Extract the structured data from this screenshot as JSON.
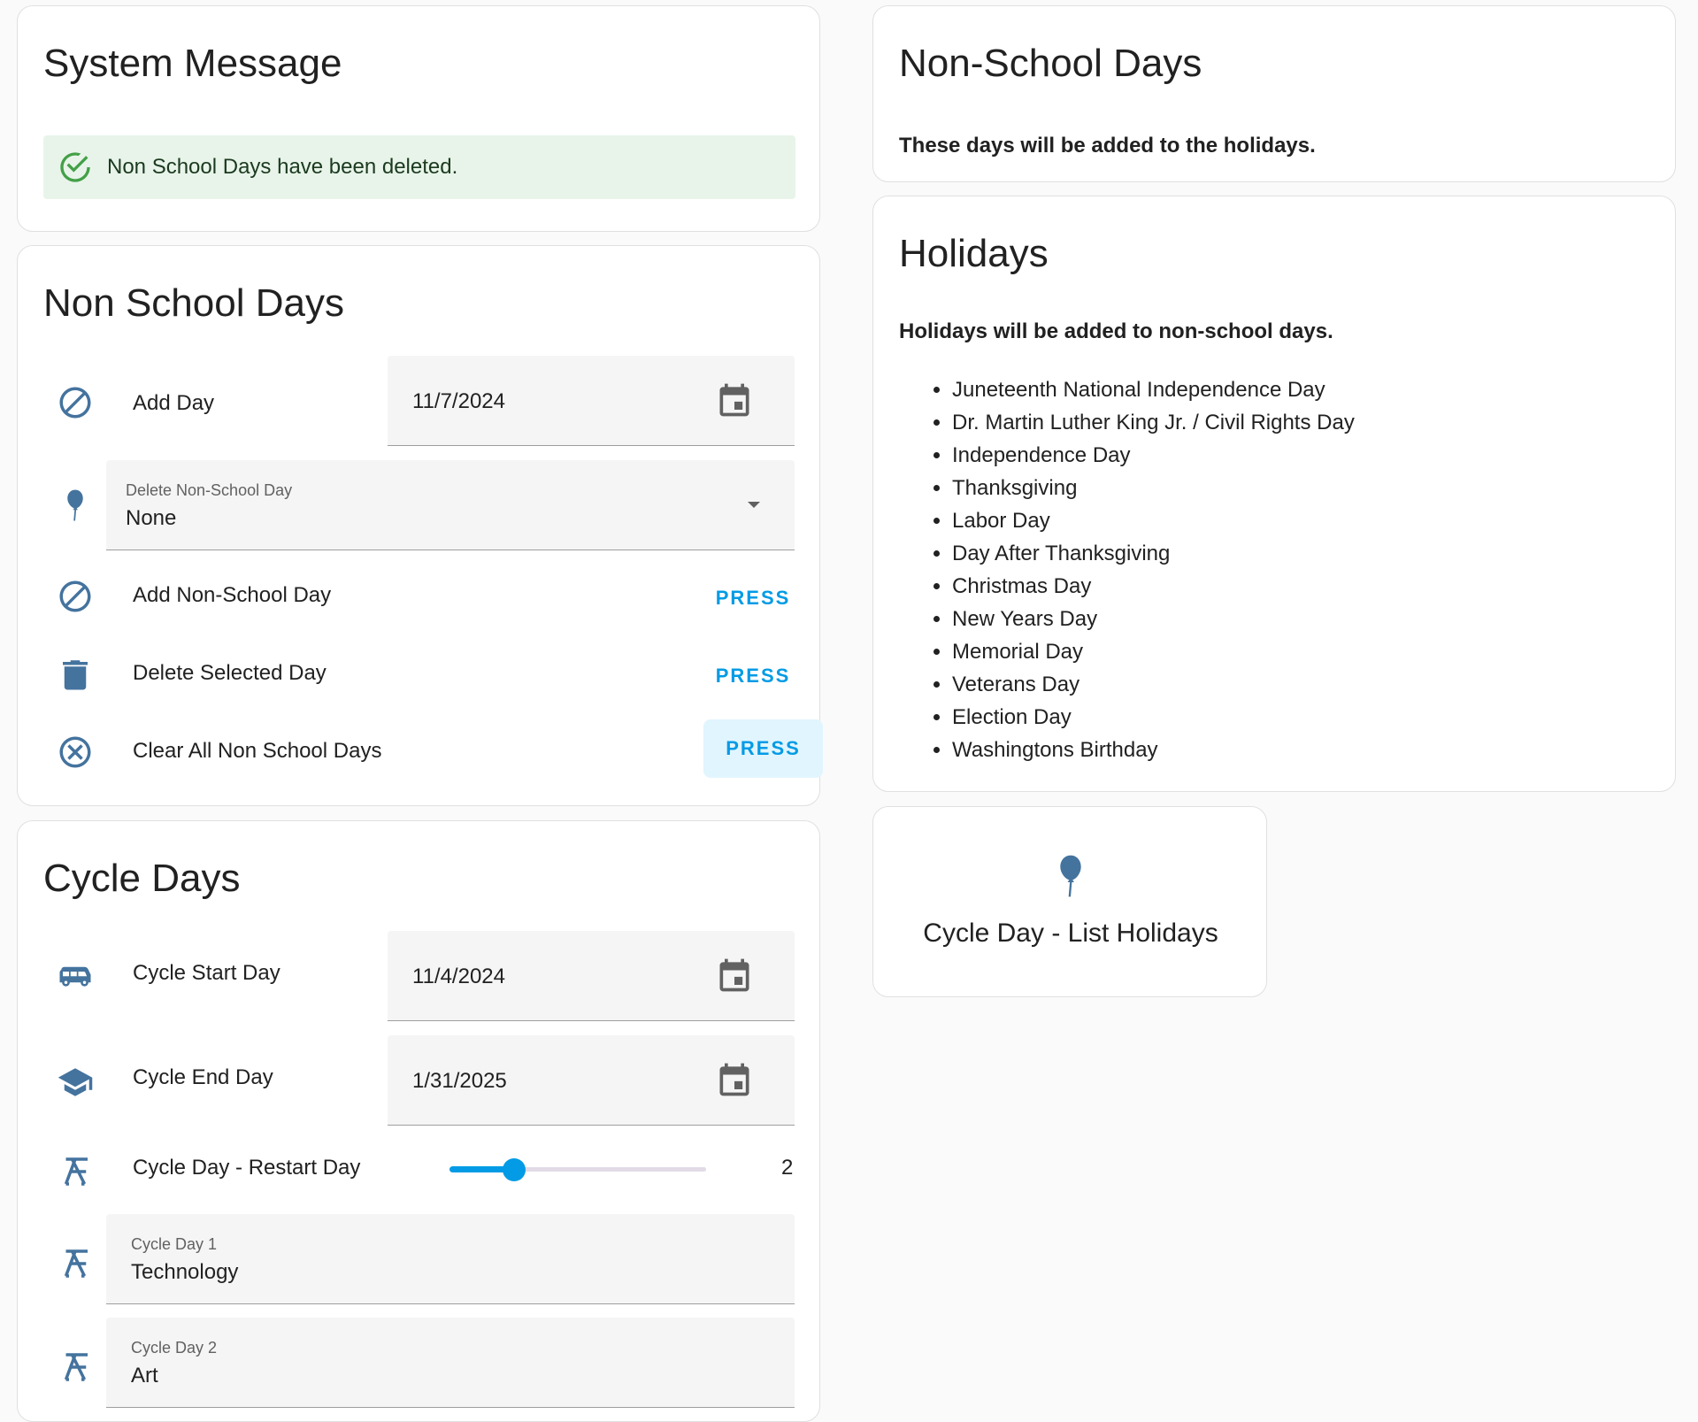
{
  "colors": {
    "icon": "#44739e",
    "accent": "#039be5",
    "success_bg": "#e8f4ea",
    "success_icon": "#43a047"
  },
  "system_message": {
    "title": "System Message",
    "alert_icon": "check-circle-icon",
    "alert_text": "Non School Days have been deleted."
  },
  "non_school": {
    "title": "Non School Days",
    "add_day": {
      "icon": "cancel-icon",
      "label": "Add Day",
      "value": "11/7/2024",
      "picker_icon": "calendar-icon"
    },
    "delete_select": {
      "icon": "balloon-icon",
      "label": "Delete Non-School Day",
      "value": "None",
      "arrow_icon": "dropdown-arrow-icon"
    },
    "add_nonschool": {
      "icon": "cancel-icon",
      "label": "Add Non-School Day",
      "button": "PRESS"
    },
    "delete_selected": {
      "icon": "trash-icon",
      "label": "Delete Selected Day",
      "button": "PRESS"
    },
    "clear_all": {
      "icon": "close-circle-icon",
      "label": "Clear All Non School Days",
      "button": "PRESS"
    }
  },
  "cycle": {
    "title": "Cycle Days",
    "start": {
      "icon": "bus-icon",
      "label": "Cycle Start Day",
      "value": "11/4/2024",
      "picker_icon": "calendar-icon"
    },
    "end": {
      "icon": "graduation-cap-icon",
      "label": "Cycle End Day",
      "value": "1/31/2025",
      "picker_icon": "calendar-icon"
    },
    "restart": {
      "icon": "desk-chair-icon",
      "label": "Cycle Day - Restart Day",
      "value": "2",
      "slider_fraction": 0.25
    },
    "day1": {
      "icon": "desk-chair-icon",
      "label": "Cycle Day 1",
      "value": "Technology"
    },
    "day2": {
      "icon": "desk-chair-icon",
      "label": "Cycle Day 2",
      "value": "Art"
    }
  },
  "nonschool_info": {
    "title": "Non-School Days",
    "description": "These days will be added to the holidays."
  },
  "holidays": {
    "title": "Holidays",
    "description": "Holidays will be added to non-school days.",
    "items": [
      "Juneteenth National Independence Day",
      "Dr. Martin Luther King Jr. / Civil Rights Day",
      "Independence Day",
      "Thanksgiving",
      "Labor Day",
      "Day After Thanksgiving",
      "Christmas Day",
      "New Years Day",
      "Memorial Day",
      "Veterans Day",
      "Election Day",
      "Washingtons Birthday"
    ]
  },
  "list_holidays_button": {
    "icon": "balloon-icon",
    "label": "Cycle Day - List Holidays"
  }
}
